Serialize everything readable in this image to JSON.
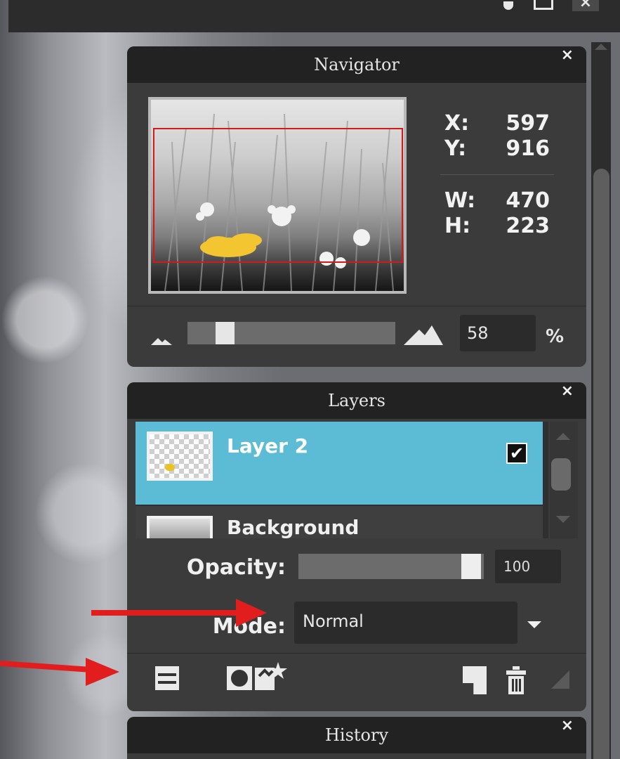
{
  "navigator": {
    "title": "Navigator",
    "close": "×",
    "x_label": "X:",
    "x_value": "597",
    "y_label": "Y:",
    "y_value": "916",
    "w_label": "W:",
    "w_value": "470",
    "h_label": "H:",
    "h_value": "223",
    "zoom_value": "58",
    "zoom_unit": "%",
    "zoom_slider_level": 0.15
  },
  "layers": {
    "title": "Layers",
    "close": "×",
    "items": [
      {
        "name": "Layer 2",
        "visible": true,
        "selected": true
      },
      {
        "name": "Background",
        "locked": true
      }
    ],
    "visibility_check": "✔",
    "opacity_label": "Opacity:",
    "opacity_value": "100",
    "mode_label": "Mode:",
    "mode_value": "Normal",
    "selection_color": "#5cbcd6"
  },
  "history": {
    "title": "History",
    "close": "×"
  },
  "window": {
    "close": "×"
  },
  "annotations": {
    "arrow_color": "#e11d1d"
  }
}
